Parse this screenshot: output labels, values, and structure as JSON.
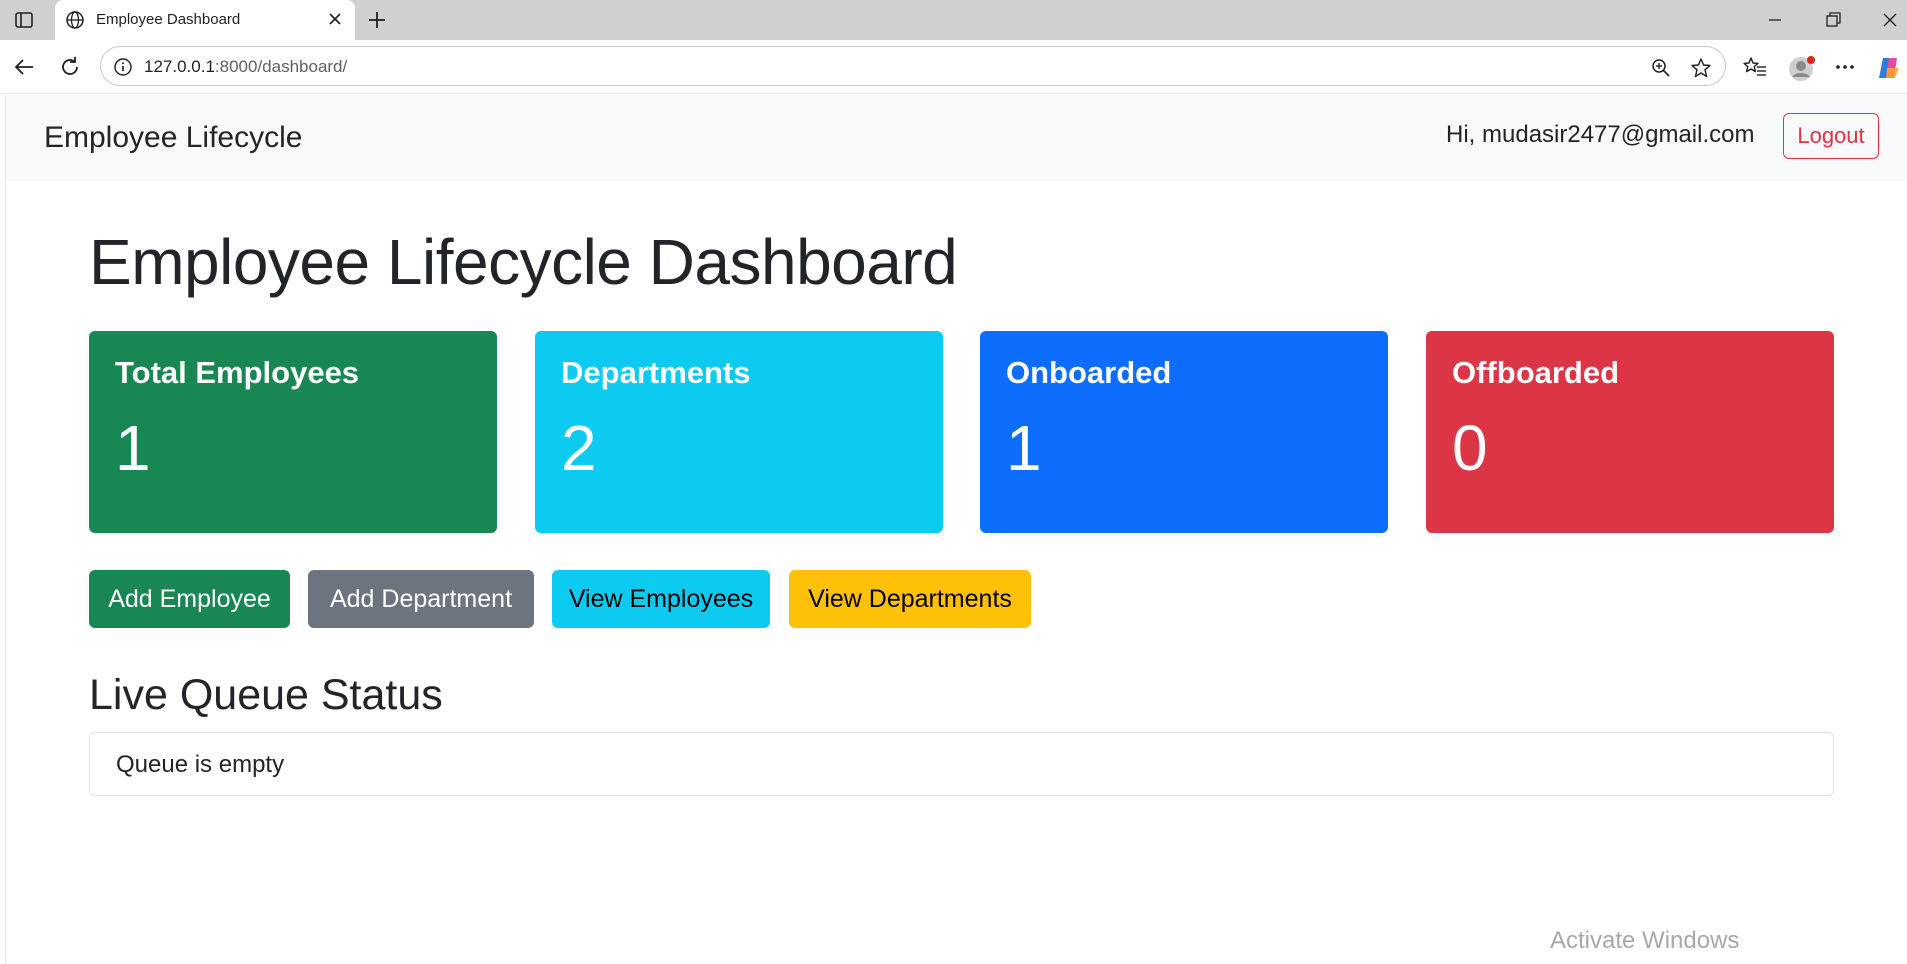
{
  "browser": {
    "tab_title": "Employee Dashboard",
    "url_host": "127.0.0.1",
    "url_path": ":8000/dashboard/"
  },
  "navbar": {
    "brand": "Employee Lifecycle",
    "greeting": "Hi, mudasir2477@gmail.com",
    "logout_label": "Logout"
  },
  "main": {
    "title": "Employee Lifecycle Dashboard",
    "stats": [
      {
        "label": "Total Employees",
        "value": "1",
        "color": "#198754"
      },
      {
        "label": "Departments",
        "value": "2",
        "color": "#0dcaf0"
      },
      {
        "label": "Onboarded",
        "value": "1",
        "color": "#0d6efd"
      },
      {
        "label": "Offboarded",
        "value": "0",
        "color": "#dc3545"
      }
    ],
    "actions": [
      {
        "label": "Add Employee",
        "color": "#198754"
      },
      {
        "label": "Add Department",
        "color": "#6c757d"
      },
      {
        "label": "View Employees",
        "color": "#0dcaf0"
      },
      {
        "label": "View Departments",
        "color": "#ffc107"
      }
    ],
    "queue_title": "Live Queue Status",
    "queue_message": "Queue is empty"
  },
  "os": {
    "watermark": "Activate Windows"
  }
}
